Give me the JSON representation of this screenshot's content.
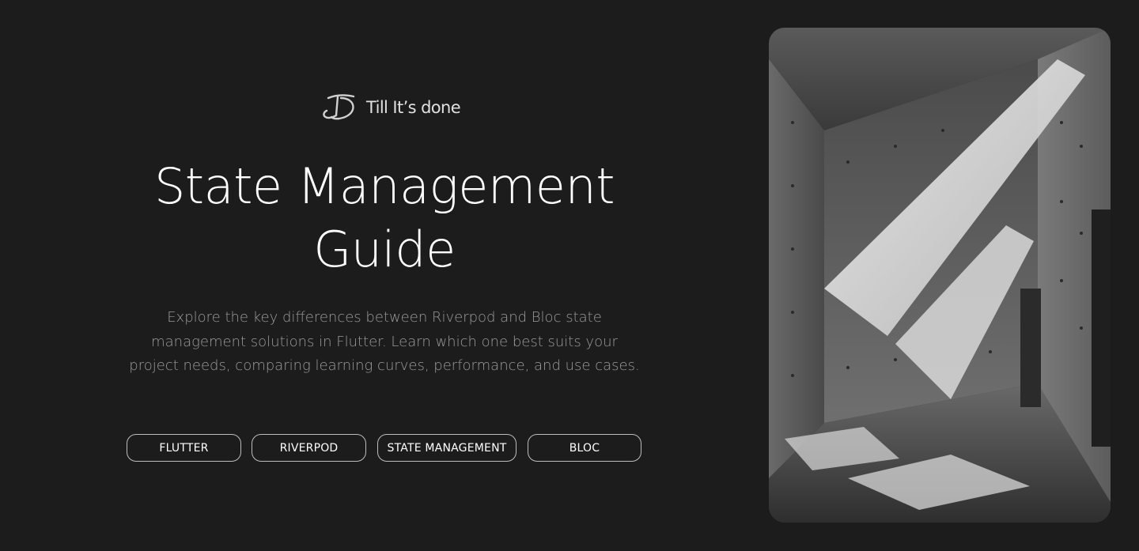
{
  "brand": {
    "name": "Till It’s done",
    "logo_icon": "td-monogram-icon"
  },
  "hero": {
    "title_line1": "State Management",
    "title_line2": "Guide",
    "description_line1": "Explore the key differences between Riverpod and Bloc state",
    "description_line2": "management solutions in Flutter. Learn which one best suits your",
    "description_line3": "project needs, comparing learning curves, performance, and use cases."
  },
  "tags": [
    {
      "label": "FLUTTER"
    },
    {
      "label": "RIVERPOD"
    },
    {
      "label": "STATE MANAGEMENT"
    },
    {
      "label": "BLOC"
    }
  ],
  "image": {
    "subject": "concrete-interior-photo",
    "colors": {
      "background": "#1c1c1c",
      "text": "#ffffff",
      "muted_text": "#9b9b9b",
      "tag_border": "#bdbdbd"
    }
  }
}
